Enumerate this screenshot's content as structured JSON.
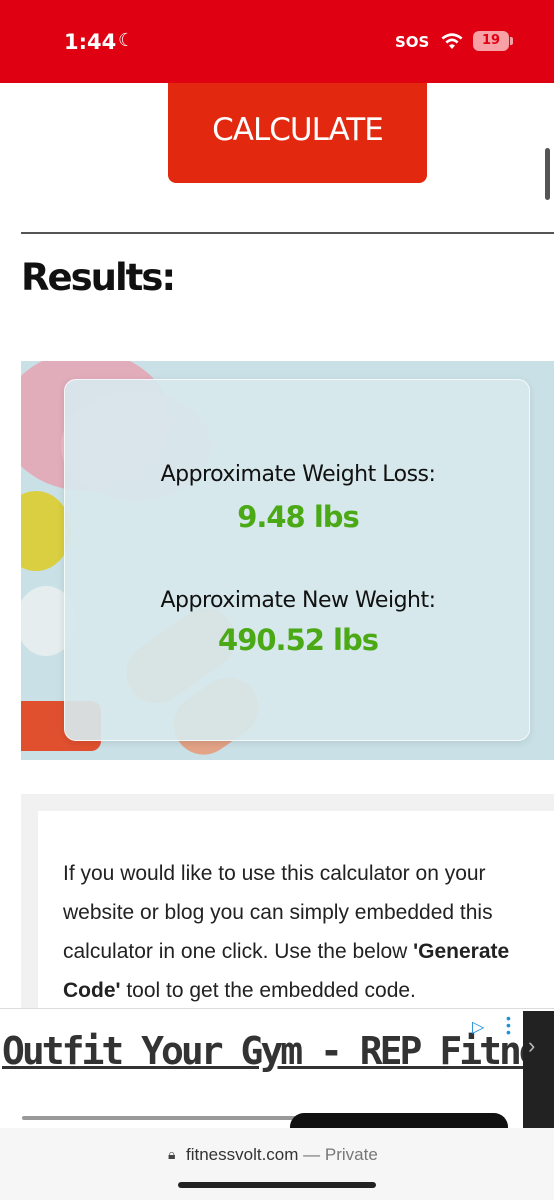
{
  "status_bar": {
    "time": "1:44",
    "sos": "SOS",
    "battery": "19"
  },
  "calculator": {
    "button_label": "CALCULATE"
  },
  "results": {
    "heading": "Results:",
    "weight_loss_label": "Approximate Weight Loss:",
    "weight_loss_value": "9.48 lbs",
    "new_weight_label": "Approximate New Weight:",
    "new_weight_value": "490.52 lbs"
  },
  "embed": {
    "text_before": "If you would like to use this calculator on your website or blog you can simply embedded this calculator in one click. Use the below ",
    "text_bold": "'Generate Code'",
    "text_after": " tool to get the embedded code."
  },
  "ad": {
    "text": "Outfit Your Gym - REP Fitness"
  },
  "browser": {
    "url": "fitnessvolt.com",
    "mode": "— Private"
  },
  "colors": {
    "status_bar": "#df0012",
    "button": "#e2290f",
    "value_green": "#4ba916"
  }
}
